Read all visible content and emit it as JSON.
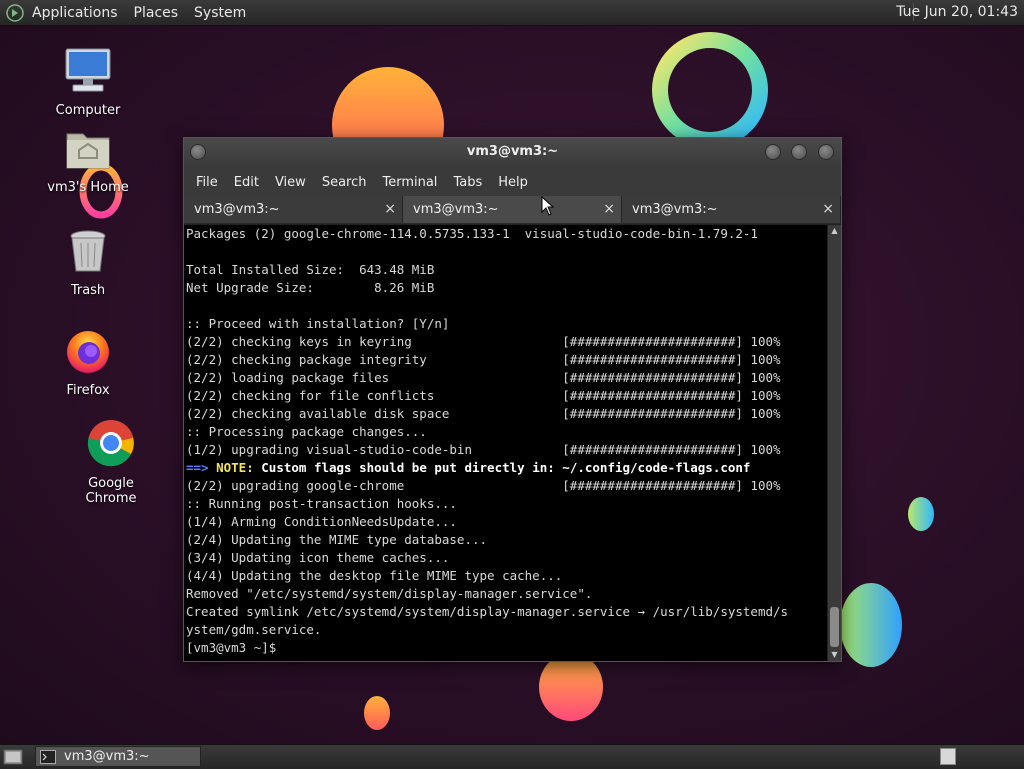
{
  "top_panel": {
    "menus": [
      "Applications",
      "Places",
      "System"
    ],
    "clock": "Tue Jun 20, 01:43"
  },
  "desktop_icons": [
    {
      "label": "Computer",
      "icon": "computer-icon"
    },
    {
      "label": "vm3's Home",
      "icon": "home-folder-icon"
    },
    {
      "label": "Trash",
      "icon": "trash-icon"
    },
    {
      "label": "Firefox",
      "icon": "firefox-icon"
    },
    {
      "label": "Google Chrome",
      "icon": "chrome-icon"
    }
  ],
  "window": {
    "title": "vm3@vm3:~",
    "menu": [
      "File",
      "Edit",
      "View",
      "Search",
      "Terminal",
      "Tabs",
      "Help"
    ],
    "tabs": [
      {
        "label": "vm3@vm3:~",
        "active": false
      },
      {
        "label": "vm3@vm3:~",
        "active": true
      },
      {
        "label": "vm3@vm3:~",
        "active": false
      }
    ],
    "tab_close_glyph": "×",
    "terminal_lines": [
      "Packages (2) google-chrome-114.0.5735.133-1  visual-studio-code-bin-1.79.2-1",
      "",
      "Total Installed Size:  643.48 MiB",
      "Net Upgrade Size:        8.26 MiB",
      "",
      ":: Proceed with installation? [Y/n]",
      "(2/2) checking keys in keyring                    [######################] 100%",
      "(2/2) checking package integrity                  [######################] 100%",
      "(2/2) loading package files                       [######################] 100%",
      "(2/2) checking for file conflicts                 [######################] 100%",
      "(2/2) checking available disk space               [######################] 100%",
      ":: Processing package changes...",
      "(1/2) upgrading visual-studio-code-bin            [######################] 100%",
      "",
      "(2/2) upgrading google-chrome                     [######################] 100%",
      ":: Running post-transaction hooks...",
      "(1/4) Arming ConditionNeedsUpdate...",
      "(2/4) Updating the MIME type database...",
      "(3/4) Updating icon theme caches...",
      "(4/4) Updating the desktop file MIME type cache...",
      "Removed \"/etc/systemd/system/display-manager.service\".",
      "Created symlink /etc/systemd/system/display-manager.service → /usr/lib/systemd/s",
      "ystem/gdm.service.",
      "[vm3@vm3 ~]$ "
    ],
    "note_line": {
      "arrow": "==> ",
      "label": "NOTE:",
      "text": " Custom flags should be put directly in: ~/.config/code-flags.conf"
    }
  },
  "taskbar": {
    "task_label": "vm3@vm3:~"
  },
  "colors": {
    "desktop_bg": "#2a0f27",
    "note_label": "#f2e25a",
    "note_arrow": "#5c7cff"
  }
}
